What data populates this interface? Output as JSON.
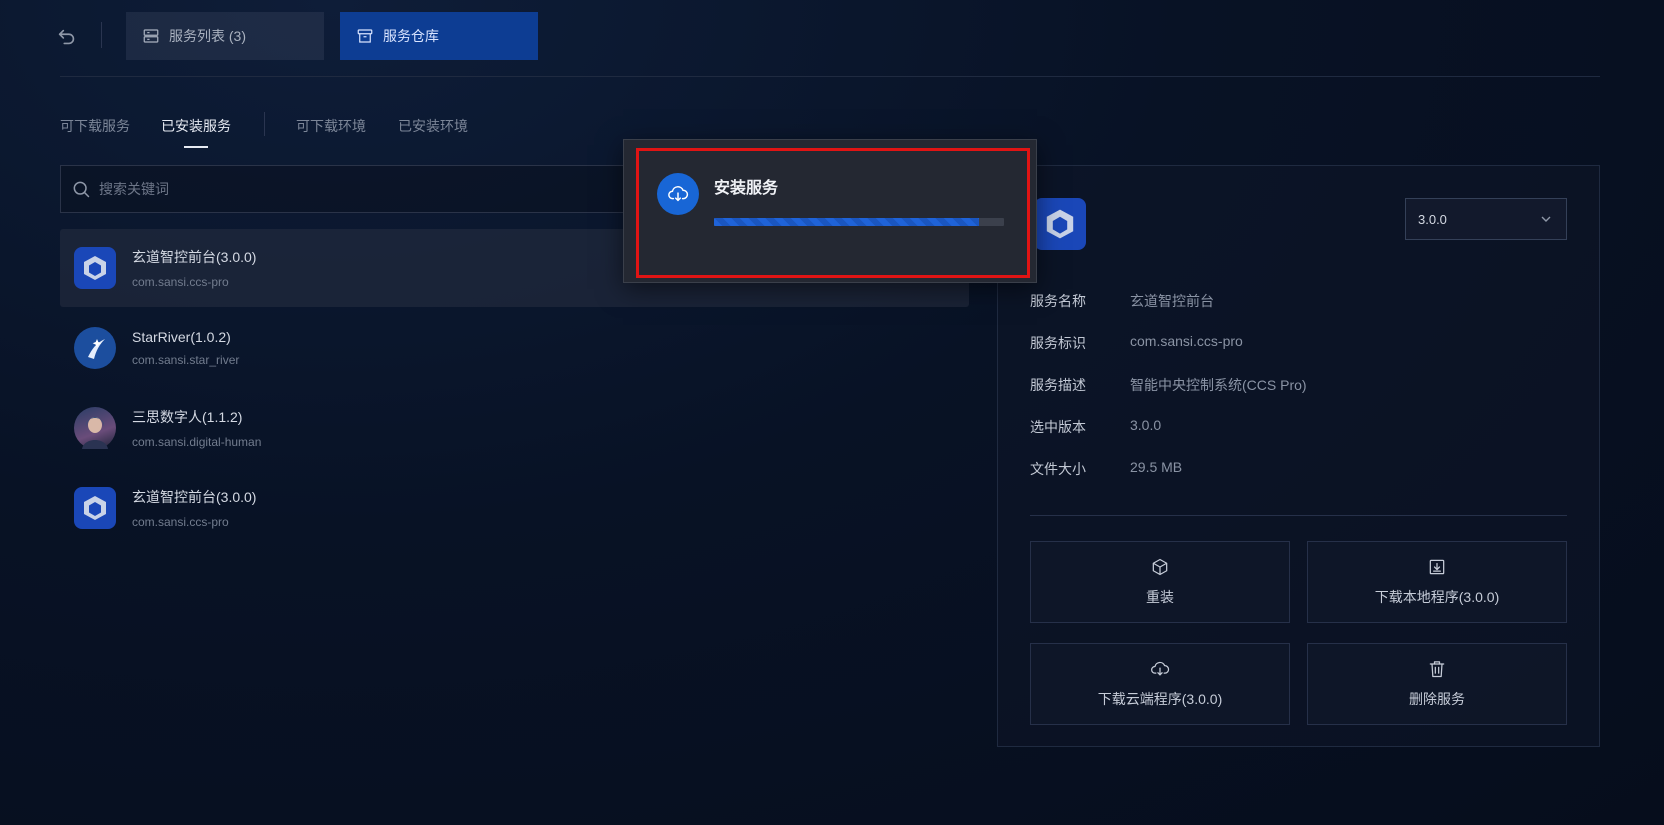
{
  "topbar": {
    "tabs": [
      {
        "label": "服务列表 (3)",
        "icon": "server-list-icon"
      },
      {
        "label": "服务仓库",
        "icon": "repository-icon",
        "active": true
      }
    ]
  },
  "subtabs": [
    {
      "label": "可下载服务"
    },
    {
      "label": "已安装服务",
      "active": true
    },
    {
      "label": "可下载环境"
    },
    {
      "label": "已安装环境"
    }
  ],
  "search": {
    "placeholder": "搜索关键词",
    "value": ""
  },
  "services": [
    {
      "title": "玄道智控前台(3.0.0)",
      "id": "com.sansi.ccs-pro",
      "icon": "hexagon-icon",
      "selected": true
    },
    {
      "title": "StarRiver(1.0.2)",
      "id": "com.sansi.star_river",
      "icon": "star-river-icon"
    },
    {
      "title": "三思数字人(1.1.2)",
      "id": "com.sansi.digital-human",
      "icon": "digital-human-avatar"
    },
    {
      "title": "玄道智控前台(3.0.0)",
      "id": "com.sansi.ccs-pro",
      "icon": "hexagon-icon"
    }
  ],
  "detail": {
    "version_selected": "3.0.0",
    "fields": [
      {
        "label": "服务名称",
        "value": "玄道智控前台"
      },
      {
        "label": "服务标识",
        "value": "com.sansi.ccs-pro"
      },
      {
        "label": "服务描述",
        "value": "智能中央控制系统(CCS Pro)"
      },
      {
        "label": "选中版本",
        "value": "3.0.0"
      },
      {
        "label": "文件大小",
        "value": "29.5 MB"
      }
    ],
    "actions": [
      {
        "label": "重装",
        "icon": "reinstall-cube-icon"
      },
      {
        "label": "下载本地程序(3.0.0)",
        "icon": "download-local-icon"
      },
      {
        "label": "下载云端程序(3.0.0)",
        "icon": "cloud-download-icon"
      },
      {
        "label": "删除服务",
        "icon": "trash-icon"
      }
    ]
  },
  "modal": {
    "title": "安装服务",
    "icon": "cloud-download-icon",
    "progress_fraction": 0.915,
    "highlight_color": "#e01414"
  },
  "colors": {
    "accent": "#1866d6",
    "active_tab": "#0d3d93"
  }
}
